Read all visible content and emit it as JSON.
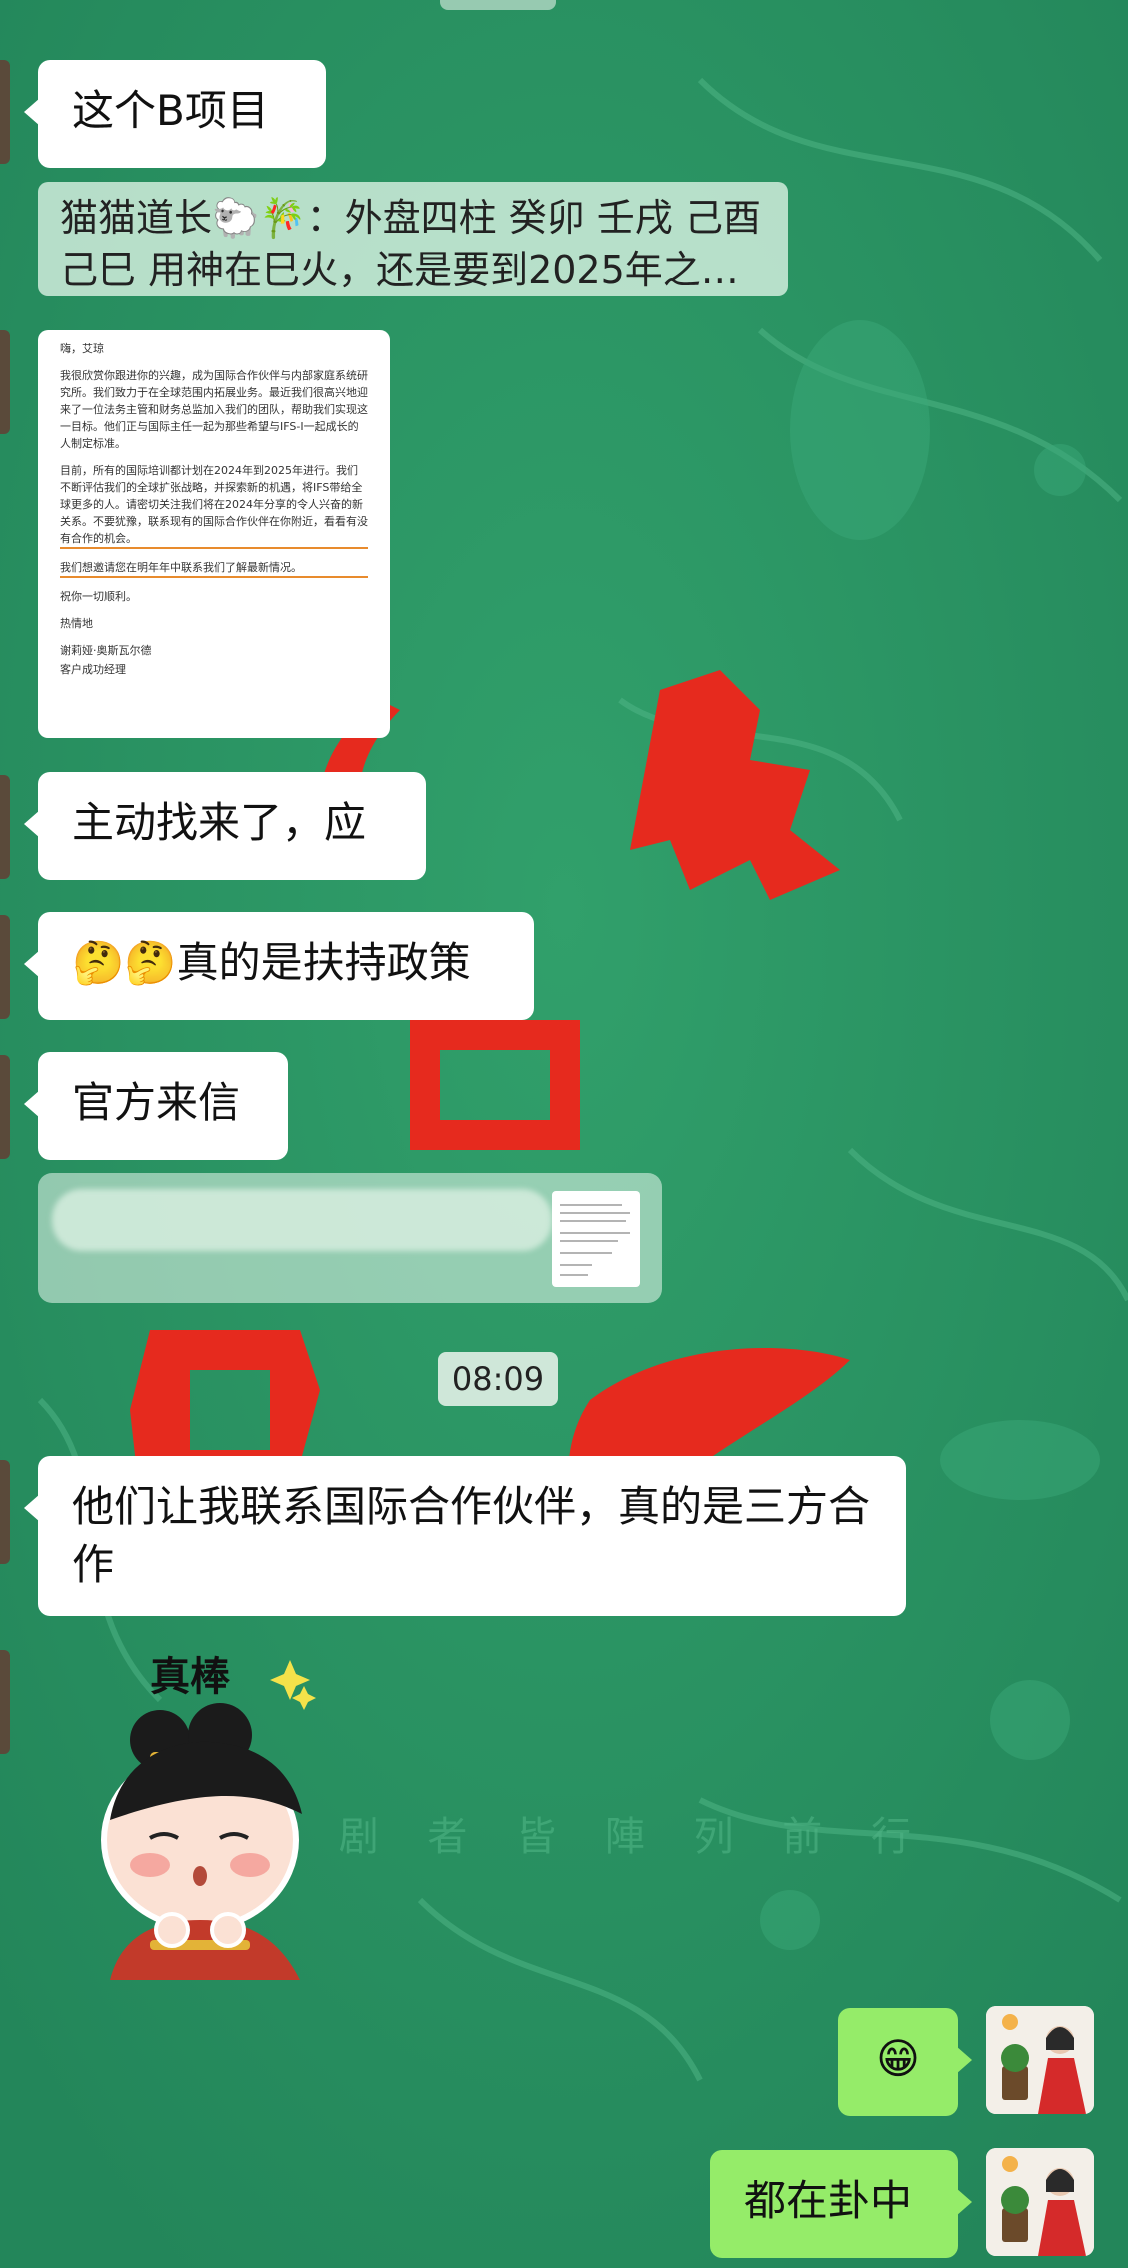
{
  "chat": {
    "messages": [
      {
        "id": "m1",
        "side": "left",
        "type": "text",
        "text": "这个B项目"
      },
      {
        "id": "m2",
        "side": "left",
        "type": "quote",
        "text": "猫猫道长🐑🎋：外盘四柱 癸卯 壬戌 己酉 己巳 用神在巳火，还是要到2025年之…"
      },
      {
        "id": "m3",
        "side": "left",
        "type": "image",
        "description": "document"
      },
      {
        "id": "m4",
        "side": "left",
        "type": "text",
        "text": "主动找来了，应"
      },
      {
        "id": "m5",
        "side": "left",
        "type": "text",
        "text": "🤔🤔真的是扶持政策"
      },
      {
        "id": "m6",
        "side": "left",
        "type": "text",
        "text": "官方来信"
      },
      {
        "id": "m7",
        "side": "left",
        "type": "quote-image"
      },
      {
        "id": "m8",
        "side": "left",
        "type": "text",
        "text": "他们让我联系国际合作伙伴，真的是三方合作"
      },
      {
        "id": "m9",
        "side": "left",
        "type": "sticker",
        "caption": "真棒"
      },
      {
        "id": "m10",
        "side": "right",
        "type": "text",
        "text": "😁"
      },
      {
        "id": "m11",
        "side": "right",
        "type": "text",
        "text": "都在卦中"
      }
    ],
    "timestamp": "08:09"
  },
  "letter": {
    "greeting": "嗨，艾琼",
    "p1": "我很欣赏你跟进你的兴趣，成为国际合作伙伴与内部家庭系统研究所。我们致力于在全球范围内拓展业务。最近我们很高兴地迎来了一位法务主管和财务总监加入我们的团队，帮助我们实现这一目标。他们正与国际主任一起为那些希望与IFS-I一起成长的人制定标准。",
    "p2": "目前，所有的国际培训都计划在2024年到2025年进行。我们不断评估我们的全球扩张战略，并探索新的机遇，将IFS带给全球更多的人。请密切关注我们将在2024年分享的令人兴奋的新关系。不要犹豫，联系现有的国际合作伙伴在你附近，看看有没有合作的机会。",
    "p3": "我们想邀请您在明年年中联系我们了解最新情况。",
    "closing1": "祝你一切顺利。",
    "closing2": "热情地",
    "signature": "谢莉娅·奥斯瓦尔德",
    "title": "客户成功经理"
  },
  "background": {
    "watermark_text": "丞 剧 者 皆 陣 列 前 行"
  },
  "colors": {
    "bg_green": "#2a9160",
    "bubble_white": "#ffffff",
    "bubble_self": "#95ec69",
    "seal_red": "#e62a1e"
  }
}
